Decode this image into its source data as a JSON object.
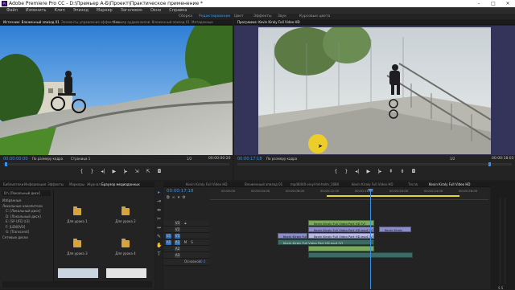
{
  "app": {
    "title": "Adobe Premiere Pro CC - D:\\Премьер А-Б\\Проект\\Практическое применение *"
  },
  "menu": [
    "Файл",
    "Изменить",
    "Клип",
    "Эпизод",
    "Маркер",
    "Заголовок",
    "Окно",
    "Справка"
  ],
  "workspaces": [
    "Сборка",
    "Редактирование",
    "Цвет",
    "Эффекты",
    "Звук",
    "Курсовые цвета"
  ],
  "source_monitor": {
    "tabs": [
      "Источник: Вложенный эпизод 01",
      "Элементы управления эффектами",
      "Микшер аудиоклипов: Вложенный эпизод 01",
      "Метаданные"
    ],
    "timecode_left": "00:00:00:00",
    "fit": "По размеру кадра",
    "page": "Страница 1",
    "scale": "1/2",
    "timecode_right": "00:00:00:20"
  },
  "program_monitor": {
    "tab": "Программа: Kevin Kiraly Full Video HD",
    "timecode_left": "00:00:17:18",
    "fit": "По размеру кадра",
    "scale": "1/2",
    "timecode_right": "00:00:18:03"
  },
  "project": {
    "tabs": [
      "Библиотеки",
      "Информация",
      "Эффекты",
      "Маркеры",
      "Журнал",
      "Браузер медиаданных"
    ],
    "drive": "D:\\ [Локальный диск]",
    "tree": [
      "Избранные",
      "Локальные накопители",
      "C: [Локальный диск]",
      "D: [Локальный диск]",
      "E: [SP UFD U3]",
      "F: [LENOVO]",
      "G: [Transcend]",
      "Сетевые диски"
    ],
    "bins": [
      "Для урока 1",
      "Для урока 2",
      "Для урока 3",
      "Для урока 4"
    ]
  },
  "timeline": {
    "tabs": [
      "Kevin Kiraly Full Video HD",
      "Вложенный эпизод 01",
      "mpd8440-vinyl-hd-helm_1080",
      "Kevin Kiraly Full Video HD",
      "Тесла",
      "Kevin Kiraly Full Video HD"
    ],
    "timecode": "00:00:17:18",
    "ruler": [
      "00:00:00",
      "00:00:04:00",
      "00:00:08:00",
      "00:00:12:00",
      "00:00:16:00",
      "00:00:20:00",
      "00:00:24:00",
      "00:00:28:00",
      "00:00:32:00"
    ],
    "tracks": [
      "V3",
      "V2",
      "V1",
      "A1",
      "A2",
      "A3",
      "Основной"
    ],
    "master_value": "0.0",
    "clips": {
      "v3": "Kevin Kiraly Full Video Part HD [V]",
      "v2_1": "Kevin Kiraly Full Video Part HD.mp4 [V]",
      "v2_2": "Kevin Kiraly",
      "v1": "Kevin Kiraly Full Video Part HD.mp4 [V]",
      "v1b": "Kevin Kiraly Full Video Part HD.mp4 [V]",
      "a1": "Kevin Kiraly Full Video Part HD.mp4 [V]",
      "label_a": "fx"
    }
  }
}
